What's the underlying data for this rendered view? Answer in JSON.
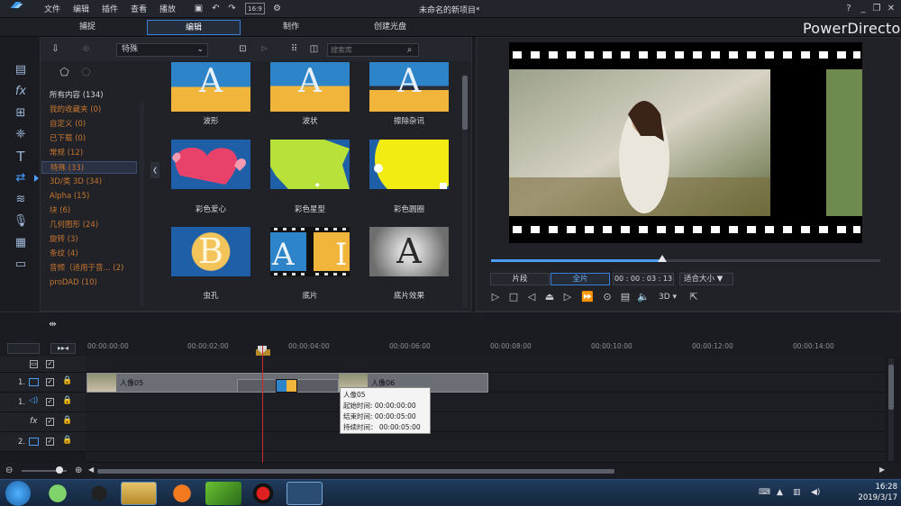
{
  "menu": [
    "文件",
    "编辑",
    "插件",
    "查看",
    "播放"
  ],
  "window_title": "未命名的新项目*",
  "modes": [
    "捕捉",
    "编辑",
    "制作",
    "创建光盘"
  ],
  "brand": "PowerDirector",
  "win_controls": [
    "?",
    "_",
    "❐",
    "✕"
  ],
  "library": {
    "category_select": "特殊",
    "search_placeholder": "搜索库",
    "tree": [
      "所有内容 (134)",
      "我的收藏夹 (0)",
      "自定义 (0)",
      "已下载 (0)",
      "常规 (12)",
      "特殊 (33)",
      "3D/类 3D (34)",
      "Alpha (15)",
      "块 (6)",
      "几何图形 (24)",
      "旋转 (3)",
      "条纹 (4)",
      "音频（适用于音... (2)",
      "proDAD (10)"
    ],
    "thumbs": [
      "波形",
      "波状",
      "擦除杂讯",
      "彩色爱心",
      "彩色星型",
      "彩色圆圈",
      "虫孔",
      "底片",
      "底片效果"
    ]
  },
  "preview": {
    "mode_clip": "片段",
    "mode_movie": "全片",
    "timecode": "00 : 00 : 03 : 13",
    "fit": "适合大小 ▼",
    "progress": 0.44,
    "three_d": "3D ▾"
  },
  "timeline": {
    "ticks": [
      "00:00:00:00",
      "00:00:02:00",
      "00:00:04:00",
      "00:00:06:00",
      "00:00:08:00",
      "00:00:10:00",
      "00:00:12:00",
      "00:00:14:00"
    ],
    "tracks": [
      "1.",
      "2."
    ],
    "clip1": "人像05",
    "clip2": "人像06",
    "tooltip": {
      "title": "人像05",
      "start": "起始时间: 00:00:00:00",
      "end": "结束时间: 00:00:05:00",
      "duration": "持续时间： 00:00:05:00"
    }
  },
  "taskbar": {
    "time": "16:28",
    "date": "2019/3/17"
  },
  "colors": {
    "accent": "#3a80d8",
    "category_text": "#c7762f",
    "playhead": "#d02b2b"
  }
}
